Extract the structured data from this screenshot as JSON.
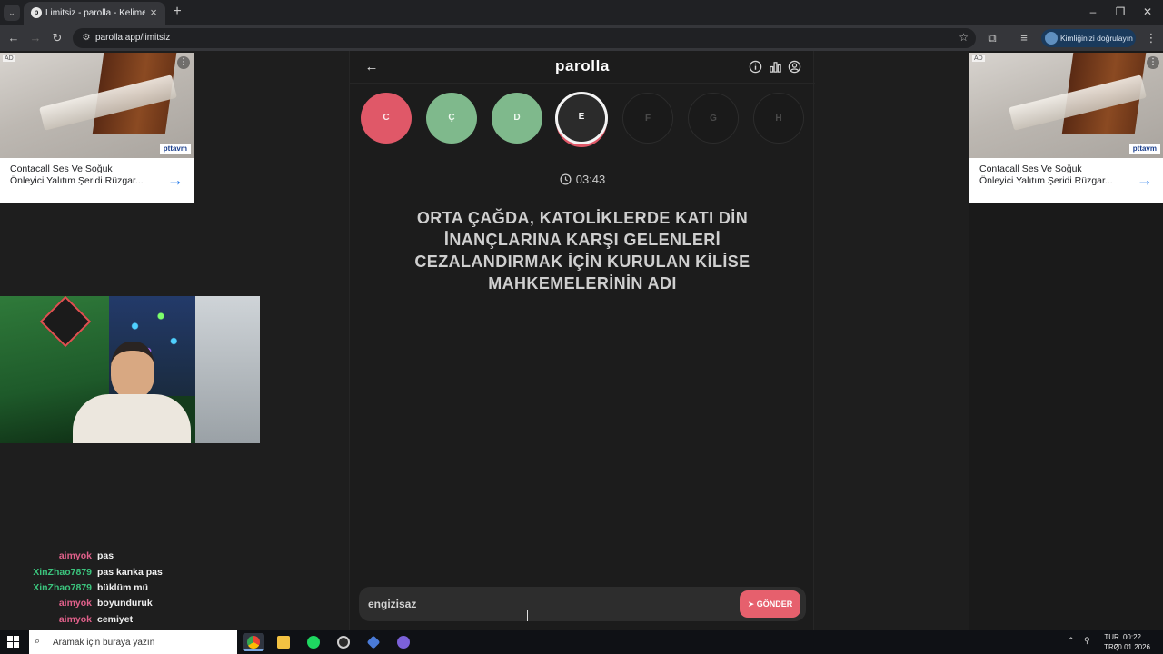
{
  "browser": {
    "tab_title": "Limitsiz - parolla - Kelime oyunu",
    "url": "parolla.app/limitsiz",
    "profile_button": "Kimliğinizi doğrulayın"
  },
  "ads": [
    {
      "badge": "AD",
      "brand": "pttavm",
      "text": "Contacall Ses Ve Soğuk Önleyici Yalıtım Şeridi Rüzgar..."
    },
    {
      "badge": "AD",
      "brand": "pttavm",
      "text": "Contacall Ses Ve Soğuk Önleyici Yalıtım Şeridi Rüzgar..."
    }
  ],
  "game": {
    "logo": "parolla",
    "letters": [
      {
        "label": "C",
        "state": "wrong"
      },
      {
        "label": "Ç",
        "state": "correct"
      },
      {
        "label": "D",
        "state": "correct"
      },
      {
        "label": "E",
        "state": "active"
      },
      {
        "label": "F",
        "state": "future"
      },
      {
        "label": "G",
        "state": "future"
      },
      {
        "label": "H",
        "state": "future"
      }
    ],
    "timer": "03:43",
    "question": "ORTA ÇAĞDA, KATOLİKLERDE KATI DİN İNANÇLARINA KARŞI GELENLERİ CEZALANDIRMAK İÇİN KURULAN KİLİSE MAHKEMELERİNİN ADI",
    "answer_value": "engizisaz",
    "send_label": "GÖNDER"
  },
  "chat": [
    {
      "user": "aimyok",
      "color": "#e0608a",
      "msg": "pas"
    },
    {
      "user": "XinZhao7879",
      "color": "#3bc47d",
      "msg": "pas kanka pas"
    },
    {
      "user": "XinZhao7879",
      "color": "#3bc47d",
      "msg": "büklüm mü"
    },
    {
      "user": "aimyok",
      "color": "#e0608a",
      "msg": "boyunduruk"
    },
    {
      "user": "aimyok",
      "color": "#e0608a",
      "msg": "cemiyet"
    }
  ],
  "taskbar": {
    "search_placeholder": "Aramak için buraya yazın",
    "lang_top": "TUR",
    "lang_bottom": "TRQ",
    "time": "00:22",
    "date": "20.01.2026"
  },
  "colors": {
    "wrong": "#e05868",
    "correct": "#7fb98c",
    "accent": "#e6606d",
    "page_bg": "#1c1c1c"
  }
}
